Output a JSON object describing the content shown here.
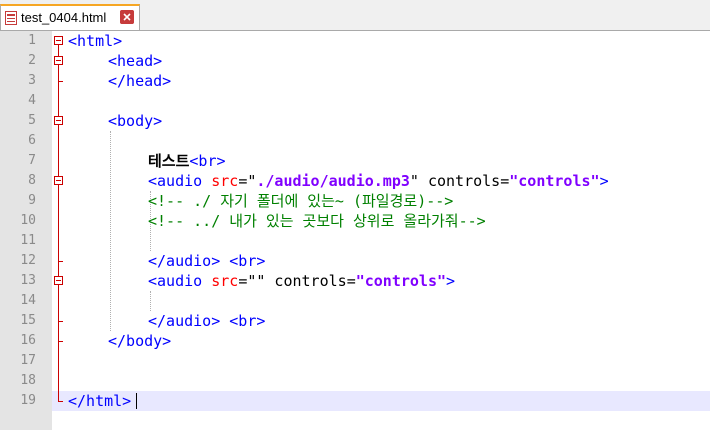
{
  "tab": {
    "label": "test_0404.html",
    "icon": "html-file-icon"
  },
  "line_numbers": [
    "1",
    "2",
    "3",
    "4",
    "5",
    "6",
    "7",
    "8",
    "9",
    "10",
    "11",
    "12",
    "13",
    "14",
    "15",
    "16",
    "17",
    "18",
    "19"
  ],
  "code": {
    "l1": {
      "tag": "<html>"
    },
    "l2": {
      "tag": "<head>"
    },
    "l3": {
      "tag": "</head>"
    },
    "l5": {
      "tag": "<body>"
    },
    "l7": {
      "text": "테스트",
      "tag": "<br>"
    },
    "l8": {
      "open": "<audio",
      "attr_src": "src",
      "eq1": "=",
      "q1": "\"",
      "src_val": "./audio/audio.mp3",
      "q2": "\"",
      "attr_controls": " controls",
      "eq2": "=",
      "controls_val": "\"controls\"",
      "close": ">"
    },
    "l9": {
      "comment": "<!-- ./ 자기 폴더에 있는~ (파일경로)-->"
    },
    "l10": {
      "comment": "<!-- ../ 내가 있는 곳보다 상위로 올라가줘-->"
    },
    "l12": {
      "close_audio": "</audio>",
      "br": "<br>"
    },
    "l13": {
      "open": "<audio",
      "attr_src": "src",
      "eq1": "=",
      "empty_val": "\"\"",
      "attr_controls": " controls",
      "eq2": "=",
      "controls_val": "\"controls\"",
      "close": ">"
    },
    "l15": {
      "close_audio": "</audio>",
      "br": "<br>"
    },
    "l16": {
      "tag": "</body>"
    },
    "l19": {
      "tag": "</html>"
    }
  },
  "colors": {
    "tag": "#0000ff",
    "attribute": "#ff0000",
    "value": "#8000ff",
    "comment": "#008000",
    "gutter": "#e4e4e4",
    "current_line": "#e8e8ff",
    "fold_marker": "#cc0000"
  }
}
